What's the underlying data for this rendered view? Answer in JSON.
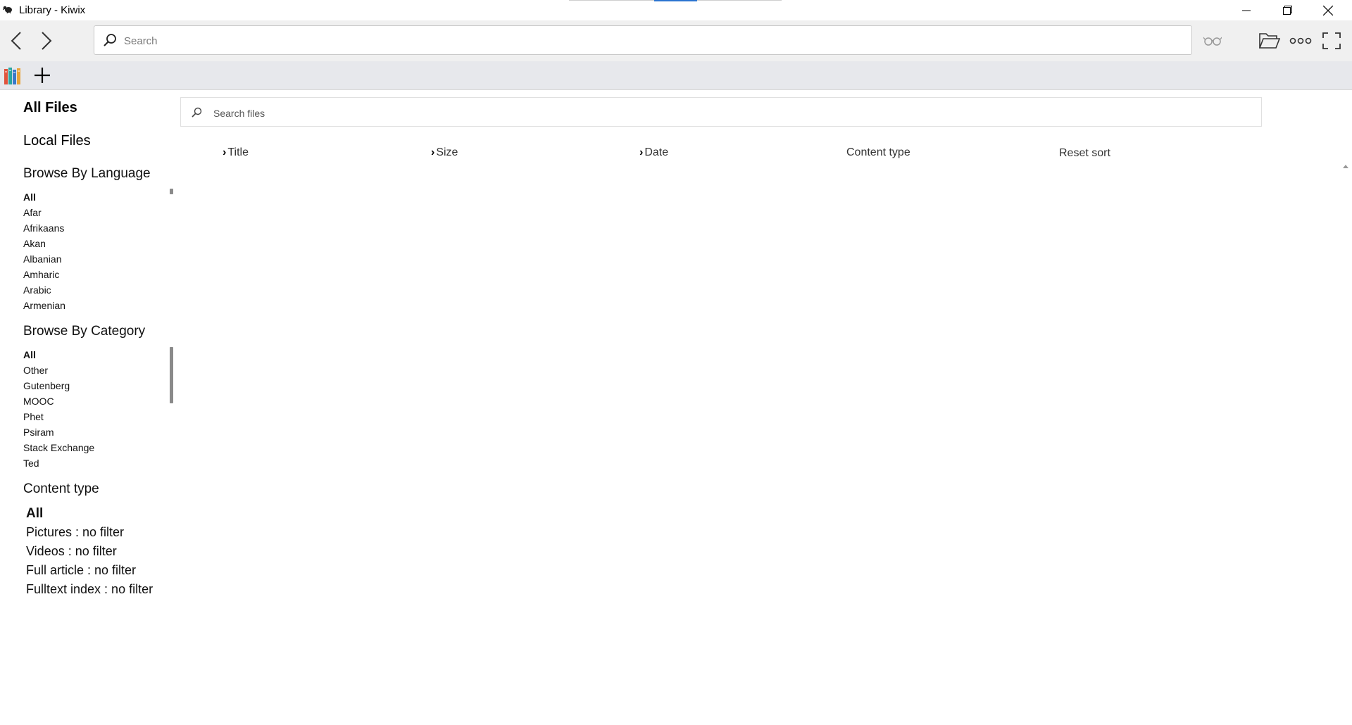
{
  "window": {
    "title": "Library - Kiwix",
    "controls": [
      "minimize-icon",
      "restore-icon",
      "close-icon"
    ]
  },
  "toolbar": {
    "back_icon": "chevron-left-icon",
    "forward_icon": "chevron-right-icon",
    "search_placeholder": "Search",
    "right_icons": [
      "reading-glasses-icon",
      "folder-open-icon",
      "more-dots-icon",
      "fullscreen-icon"
    ]
  },
  "tabs": {
    "library_icon": "library-books-icon",
    "add_label": "+"
  },
  "sidebar": {
    "all_files": "All Files",
    "local_files": "Local Files",
    "language_heading": "Browse By Language",
    "languages": [
      "All",
      "Afar",
      "Afrikaans",
      "Akan",
      "Albanian",
      "Amharic",
      "Arabic",
      "Armenian"
    ],
    "category_heading": "Browse By Category",
    "categories": [
      "All",
      "Other",
      "Gutenberg",
      "MOOC",
      "Phet",
      "Psiram",
      "Stack Exchange",
      "Ted"
    ],
    "content_type_heading": "Content type",
    "content_types": [
      "All",
      "Pictures : no filter",
      "Videos : no filter",
      "Full article : no filter",
      "Fulltext index : no filter"
    ]
  },
  "main": {
    "search_placeholder": "Search files",
    "columns": {
      "title": "Title",
      "size": "Size",
      "date": "Date",
      "content_type": "Content type",
      "reset": "Reset sort"
    }
  },
  "colors": {
    "toolbar_bg": "#f0f0f0",
    "tabbar_bg": "#e7e8ec",
    "accent_blue": "#2b74d1"
  }
}
